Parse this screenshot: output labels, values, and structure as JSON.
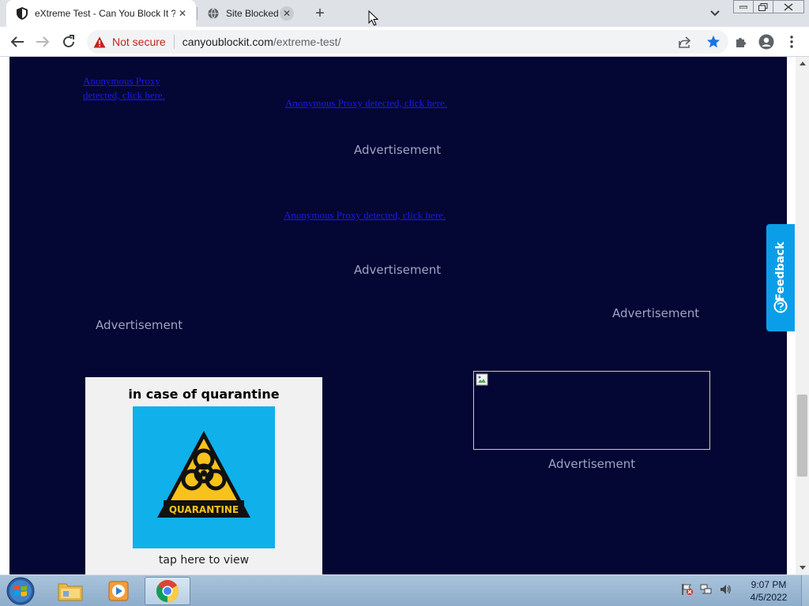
{
  "browser": {
    "tabs": [
      {
        "title": "eXtreme Test - Can You Block It ?",
        "active": true,
        "favicon": "shield-icon"
      },
      {
        "title": "Site Blocked",
        "active": false,
        "favicon": "globe-icon"
      }
    ],
    "new_tab_label": "+",
    "address": {
      "security_label": "Not secure",
      "host": "canyoublockit.com",
      "path": "/extreme-test/"
    }
  },
  "page": {
    "ad_links": [
      "Anonymous Proxy detected, click here.",
      "Anonymous Proxy detected, click here.",
      "Anonymous Proxy detected, click here."
    ],
    "ad_labels": [
      "Advertisement",
      "Advertisement",
      "Advertisement",
      "Advertisement",
      "Advertisement"
    ],
    "quarantine": {
      "title": "in case of quarantine",
      "sign_text": "QUARANTINE",
      "caption": "tap here to view"
    },
    "feedback_label": "Feedback",
    "colors": {
      "background": "#040633",
      "link": "#1a1aee",
      "feedback": "#0b9ee8",
      "sign_bg": "#10b0ea"
    }
  },
  "taskbar": {
    "time": "9:07 PM",
    "date": "4/5/2022"
  }
}
